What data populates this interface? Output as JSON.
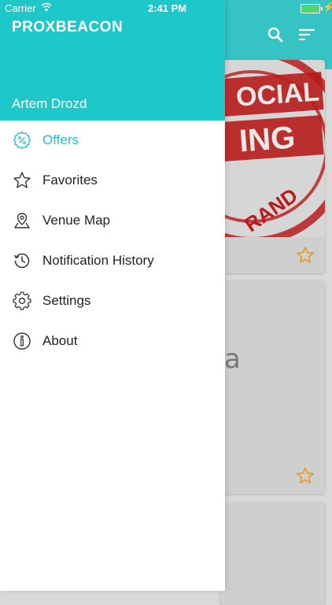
{
  "status_bar": {
    "carrier": "Carrier",
    "time": "2:41 PM"
  },
  "drawer": {
    "brand": "PROXBEACON",
    "user_name": "Artem Drozd",
    "items": [
      {
        "label": "Offers",
        "icon": "percent-badge-icon",
        "active": true
      },
      {
        "label": "Favorites",
        "icon": "star-icon",
        "active": false
      },
      {
        "label": "Venue Map",
        "icon": "map-pin-icon",
        "active": false
      },
      {
        "label": "Notification History",
        "icon": "history-icon",
        "active": false
      },
      {
        "label": "Settings",
        "icon": "gear-icon",
        "active": false
      },
      {
        "label": "About",
        "icon": "info-icon",
        "active": false
      }
    ]
  },
  "background": {
    "stamp_text_1": "OCIAL",
    "stamp_text_2": "ING",
    "stamp_text_3": "RAND",
    "partial_text": "a"
  },
  "colors": {
    "drawer_header": "#1ec7c9",
    "app_header": "#35c3c4",
    "active_item": "#26c2c9",
    "star": "#e59a1a"
  }
}
